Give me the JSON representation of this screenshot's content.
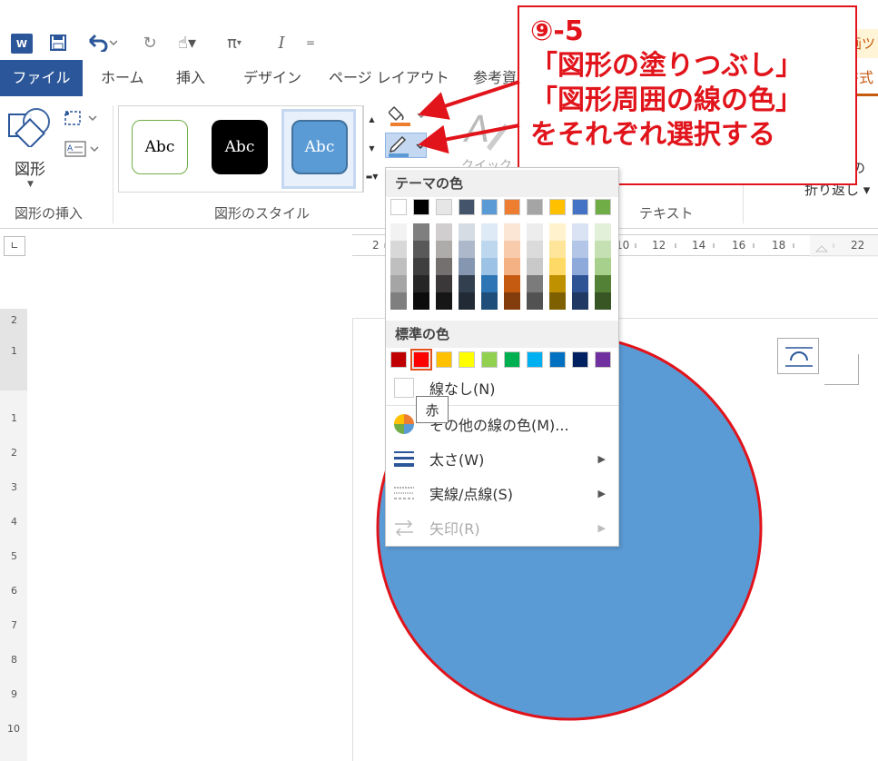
{
  "quick_access": {
    "word_icon": "W",
    "save_icon": "save-icon",
    "undo_icon": "undo-icon",
    "redo_icon": "redo-icon",
    "touch_icon": "touch-mode-icon",
    "equation_icon": "π",
    "italic_icon": "I",
    "customize_icon": "="
  },
  "tabs": [
    "ファイル",
    "ホーム",
    "挿入",
    "デザイン",
    "ページ レイアウト",
    "参考資"
  ],
  "right_tab_fragments": {
    "top": "画ツ",
    "bottom": "書式"
  },
  "ribbon": {
    "insert_group": {
      "label": "図形の挿入",
      "shapes_button": "図形"
    },
    "styles_group": {
      "label": "図形のスタイル",
      "samples": [
        "Abc",
        "Abc",
        "Abc"
      ]
    },
    "text_group": {
      "label": "テキスト",
      "quick_fragment": "クイック",
      "wrap_fragment": "折り返し",
      "right_fragment": "の"
    }
  },
  "callout": {
    "lines": [
      "⑨-5",
      "「図形の塗りつぶし」",
      "「図形周囲の線の色」",
      "をそれぞれ選択する"
    ]
  },
  "ruler": {
    "labels": [
      "2",
      "10",
      "12",
      "14",
      "16",
      "18",
      "22"
    ]
  },
  "vertical_ruler": {
    "labels": [
      "2",
      "1",
      "1",
      "2",
      "3",
      "4",
      "5",
      "6",
      "7",
      "8",
      "9",
      "10"
    ]
  },
  "dropdown": {
    "theme_header": "テーマの色",
    "standard_header": "標準の色",
    "theme_top_row": [
      "#ffffff",
      "#000000",
      "#e7e6e6",
      "#44546a",
      "#5b9bd5",
      "#ed7d31",
      "#a5a5a5",
      "#ffc000",
      "#4472c4",
      "#70ad47"
    ],
    "theme_shades": [
      [
        "#f2f2f2",
        "#7f7f7f",
        "#d0cece",
        "#d6dce4",
        "#deebf6",
        "#fbe5d5",
        "#ededed",
        "#fff2cc",
        "#dae3f3",
        "#e2efd9"
      ],
      [
        "#d8d8d8",
        "#595959",
        "#aeabab",
        "#adb9ca",
        "#bdd7ee",
        "#f8cbad",
        "#dbdbdb",
        "#fee599",
        "#b4c6e7",
        "#c5e0b3"
      ],
      [
        "#bfbfbf",
        "#3f3f3f",
        "#757070",
        "#8496b0",
        "#9cc3e5",
        "#f4b183",
        "#c9c9c9",
        "#ffd965",
        "#8eaadb",
        "#a8d08d"
      ],
      [
        "#a5a5a5",
        "#262626",
        "#3a3838",
        "#323f4f",
        "#2e75b5",
        "#c55a11",
        "#7b7b7b",
        "#bf9000",
        "#2f5496",
        "#538135"
      ],
      [
        "#7f7f7f",
        "#0c0c0c",
        "#171616",
        "#222a35",
        "#1e4e79",
        "#833c0b",
        "#525252",
        "#7f6000",
        "#1f3864",
        "#375623"
      ]
    ],
    "standard_colors": [
      "#c00000",
      "#ff0000",
      "#ffc000",
      "#ffff00",
      "#92d050",
      "#00b050",
      "#00b0f0",
      "#0070c0",
      "#002060",
      "#7030a0"
    ],
    "no_line": "線なし(N)",
    "more_colors": "その他の線の色(M)...",
    "weight": "太さ(W)",
    "dashes": "実線/点線(S)",
    "arrows": "矢印(R)",
    "tooltip": "赤"
  },
  "shape": {
    "fill": "#5b9bd5",
    "stroke": "#e1141b"
  }
}
